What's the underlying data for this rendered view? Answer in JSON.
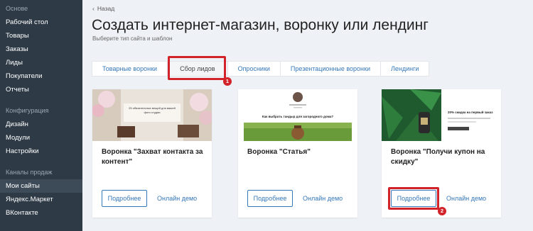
{
  "sidebar": {
    "sections": [
      {
        "title": "Основе",
        "items": [
          "Рабочий стол",
          "Товары",
          "Заказы",
          "Лиды",
          "Покупатели",
          "Отчеты"
        ]
      },
      {
        "title": "Конфигурация",
        "items": [
          "Дизайн",
          "Модули",
          "Настройки"
        ]
      },
      {
        "title": "Каналы продаж",
        "items": [
          "Мои сайты",
          "Яндекс.Маркет",
          "ВКонтакте"
        ]
      }
    ],
    "active_item": "Мои сайты"
  },
  "header": {
    "back_label": "Назад",
    "title": "Создать интернет-магазин, воронку или лендинг",
    "subtitle": "Выберите тип сайта и шаблон"
  },
  "tabs": [
    "Товарные воронки",
    "Сбор лидов",
    "Опросники",
    "Презентационные воронки",
    "Лендинги"
  ],
  "active_tab": "Сбор лидов",
  "cards": [
    {
      "name": "Воронка \"Захват контакта за контент\"",
      "more_label": "Подробнее",
      "demo_label": "Онлайн демо",
      "thumb_text": "25 обязательных вещей для вашей фото студии"
    },
    {
      "name": "Воронка \"Статья\"",
      "more_label": "Подробнее",
      "demo_label": "Онлайн демо",
      "thumb_text": "Как выбрать тандыр для загородного дома?"
    },
    {
      "name": "Воронка \"Получи купон на скидку\"",
      "more_label": "Подробнее",
      "demo_label": "Онлайн демо",
      "thumb_text": "20% скидка на первый заказ"
    }
  ],
  "annotations": {
    "badge_1": "1",
    "badge_2": "2"
  },
  "colors": {
    "sidebar_bg": "#2e3a46",
    "accent": "#3578b8",
    "highlight": "#d2232a"
  }
}
